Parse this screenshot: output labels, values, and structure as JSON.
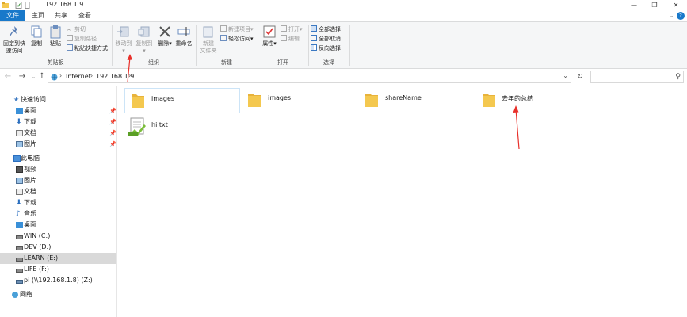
{
  "window": {
    "title": "192.168.1.9",
    "controls": {
      "minimize": "—",
      "restore": "❐",
      "close": "✕"
    }
  },
  "tabs": [
    {
      "label": "文件"
    },
    {
      "label": "主页"
    },
    {
      "label": "共享"
    },
    {
      "label": "查看"
    }
  ],
  "ribbon": {
    "clipboard": {
      "pin_label_1": "固定到快",
      "pin_label_2": "速访问",
      "copy": "复制",
      "paste": "粘贴",
      "cut": "剪切",
      "copy_path": "复制路径",
      "paste_shortcut": "粘贴快捷方式",
      "group_label": "剪贴板"
    },
    "organize": {
      "move_to": "移动到",
      "copy_to": "复制到",
      "delete": "删除",
      "rename": "重命名",
      "group_label": "组织"
    },
    "new": {
      "new_folder_1": "新建",
      "new_folder_2": "文件夹",
      "new_item": "新建项目",
      "easy_access": "轻松访问",
      "group_label": "新建"
    },
    "open": {
      "properties": "属性",
      "open": "打开",
      "edit": "编辑",
      "group_label": "打开"
    },
    "select": {
      "select_all": "全部选择",
      "select_none": "全部取消",
      "invert": "反向选择",
      "group_label": "选择"
    }
  },
  "address": {
    "crumbs": [
      "Internet",
      "192.168.1.9"
    ],
    "search_placeholder": ""
  },
  "sidebar": {
    "items": [
      {
        "label": "快速访问",
        "icon": "star-icon",
        "pinned": false
      },
      {
        "label": "桌面",
        "icon": "desktop-icon",
        "pinned": true
      },
      {
        "label": "下载",
        "icon": "download-icon",
        "pinned": true
      },
      {
        "label": "文档",
        "icon": "document-icon",
        "pinned": true
      },
      {
        "label": "图片",
        "icon": "picture-icon",
        "pinned": true
      },
      {
        "label": "此电脑",
        "icon": "computer-icon",
        "pinned": false
      },
      {
        "label": "视频",
        "icon": "video-icon",
        "pinned": false
      },
      {
        "label": "图片",
        "icon": "picture-icon",
        "pinned": false
      },
      {
        "label": "文档",
        "icon": "document-icon",
        "pinned": false
      },
      {
        "label": "下载",
        "icon": "download-icon",
        "pinned": false
      },
      {
        "label": "音乐",
        "icon": "music-icon",
        "pinned": false
      },
      {
        "label": "桌面",
        "icon": "desktop-icon",
        "pinned": false
      },
      {
        "label": "WIN (C:)",
        "icon": "drive-icon",
        "pinned": false
      },
      {
        "label": "DEV (D:)",
        "icon": "drive-icon",
        "pinned": false
      },
      {
        "label": "LEARN (E:)",
        "icon": "drive-icon",
        "pinned": false
      },
      {
        "label": "LIFE (F:)",
        "icon": "drive-icon",
        "pinned": false
      },
      {
        "label": "pi (\\\\192.168.1.8) (Z:)",
        "icon": "network-drive-icon",
        "pinned": false
      },
      {
        "label": "网络",
        "icon": "network-icon",
        "pinned": false
      }
    ],
    "pin_glyph": "📌"
  },
  "files": [
    {
      "name": "images",
      "type": "folder"
    },
    {
      "name": "images",
      "type": "folder"
    },
    {
      "name": "shareName",
      "type": "folder"
    },
    {
      "name": "去年的总结",
      "type": "folder"
    },
    {
      "name": "hi.txt",
      "type": "text"
    }
  ],
  "colors": {
    "accent": "#1979ca",
    "folder": "#f4c84f",
    "annotation": "#e8302a",
    "selected": "#d9d9d9"
  }
}
